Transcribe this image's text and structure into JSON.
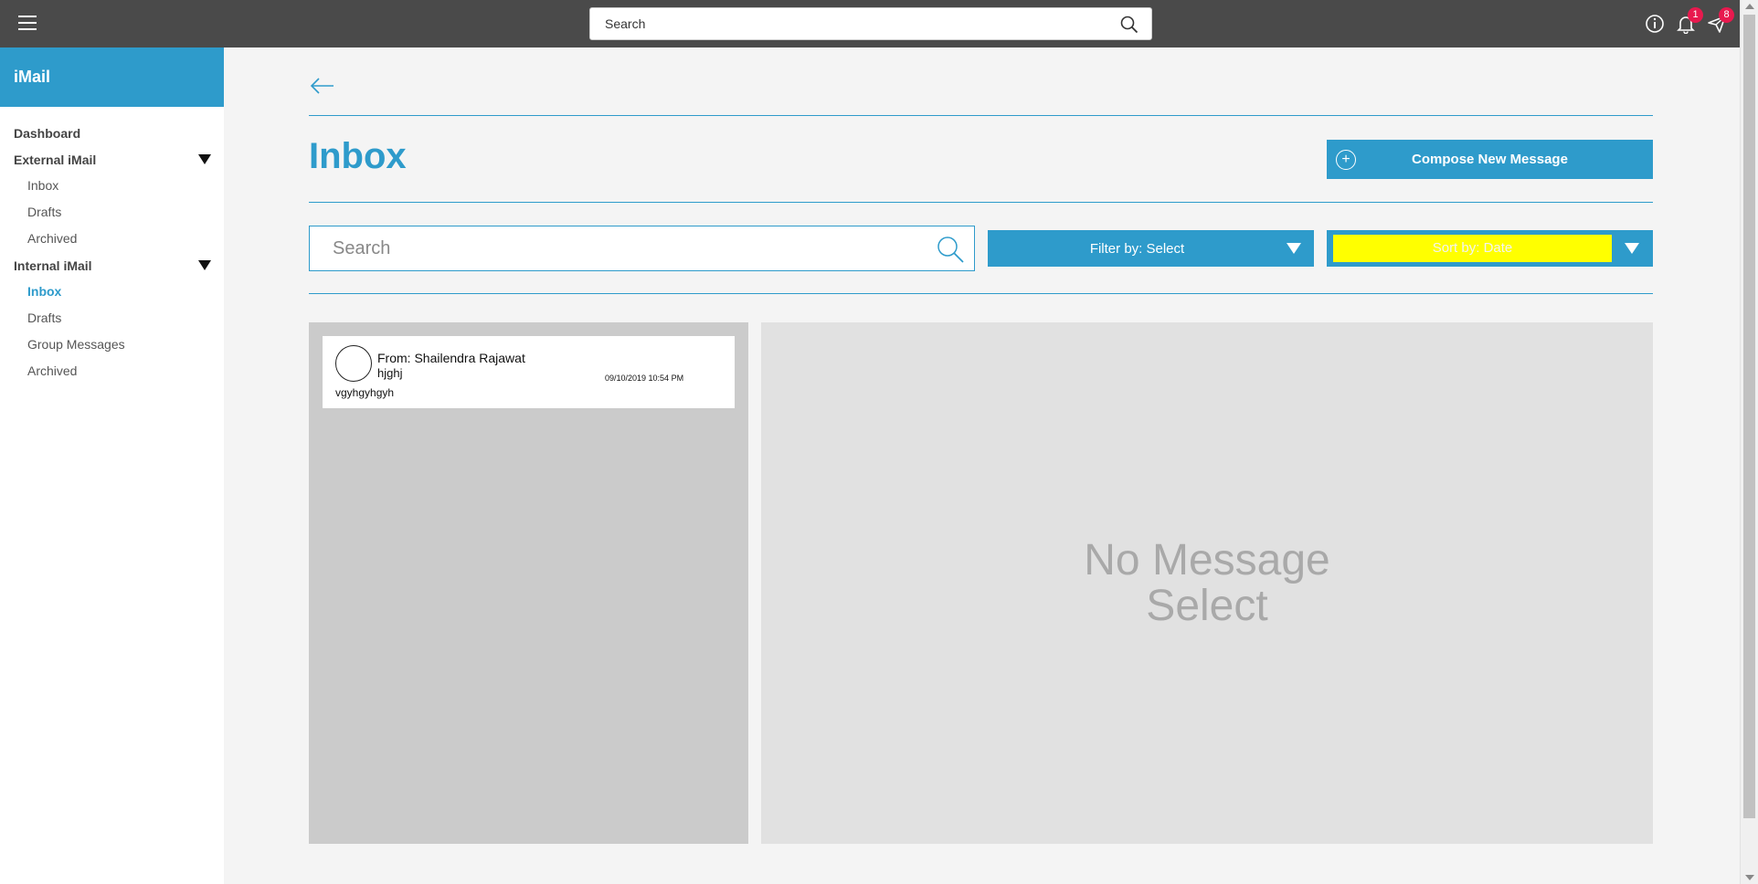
{
  "topbar": {
    "search_placeholder": "Search",
    "notifications_count": "1",
    "messages_count": "8"
  },
  "sidebar": {
    "brand": "iMail",
    "dashboard": "Dashboard",
    "external_group": "External iMail",
    "external_items": [
      "Inbox",
      "Drafts",
      "Archived"
    ],
    "internal_group": "Internal iMail",
    "internal_items": [
      "Inbox",
      "Drafts",
      "Group Messages",
      "Archived"
    ],
    "active_item": "Internal iMail / Inbox"
  },
  "main": {
    "title": "Inbox",
    "compose_label": "Compose New Message",
    "search_placeholder": "Search",
    "filter_label": "Filter by: Select",
    "sort_label": "Sort by: Date"
  },
  "messages": [
    {
      "from": "From: Shailendra Rajawat",
      "subject": "hjghj",
      "date": "09/10/2019 10:54 PM",
      "preview": "vgyhgyhgyh"
    }
  ],
  "detail": {
    "empty_text": "No Message Select"
  },
  "colors": {
    "accent": "#2e9bcb",
    "topbar": "#4a4a4a",
    "badge": "#e8194e",
    "sort_highlight": "#ffff00"
  }
}
